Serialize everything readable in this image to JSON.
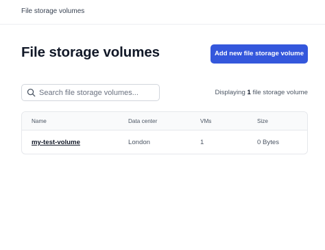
{
  "header": {
    "breadcrumb": "File storage volumes"
  },
  "main": {
    "title": "File storage volumes",
    "add_button_label": "Add new file storage volume"
  },
  "search": {
    "placeholder": "Search file storage volumes...",
    "value": ""
  },
  "summary": {
    "prefix": "Displaying",
    "count": "1",
    "suffix": "file storage volume"
  },
  "table": {
    "columns": [
      "Name",
      "Data center",
      "VMs",
      "Size"
    ],
    "rows": [
      {
        "name": "my-test-volume",
        "data_center": "London",
        "vms": "1",
        "size": "0 Bytes"
      }
    ]
  },
  "colors": {
    "accent": "#3457dc",
    "text": "#111827",
    "muted": "#4b5563",
    "border": "#e5e7eb"
  }
}
